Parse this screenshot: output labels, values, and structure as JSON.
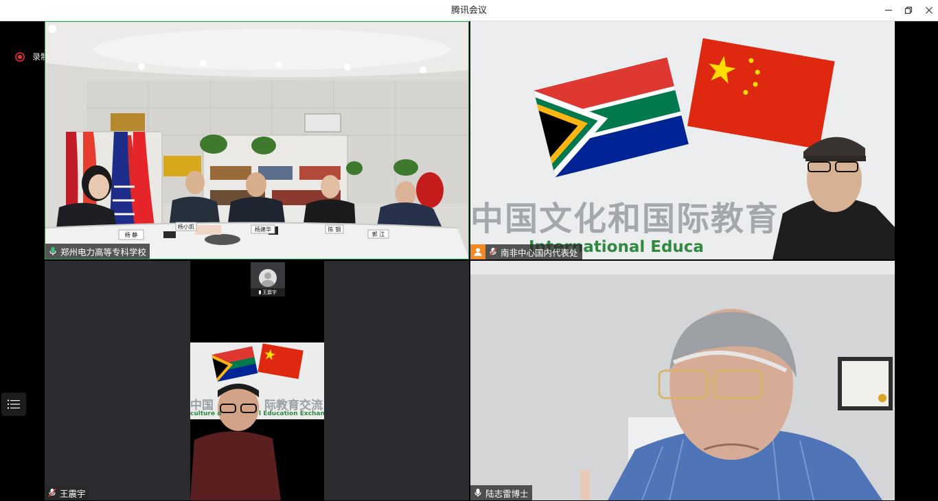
{
  "window": {
    "title": "腾讯会议",
    "minimize_icon": "minimize-icon",
    "restore_icon": "restore-icon",
    "close_icon": "close-icon"
  },
  "recording": {
    "label": "录制中",
    "color": "#e4393c"
  },
  "tiles": [
    {
      "name": "郑州电力高等专科学校",
      "mic": "mic-on"
    },
    {
      "name": "南非中心国内代表处",
      "mic": "mic-muted",
      "avatar": "user-icon"
    },
    {
      "name": "王震宇",
      "mic": "mic-muted",
      "thumb_name": "王震宇"
    },
    {
      "name": "陆志雷博士",
      "mic": "mic-on"
    }
  ],
  "backdrop": {
    "banner_cn": "中国文化和国际教育",
    "banner_en": "International Educa",
    "banner_cn_small": "中国",
    "banner_cn_small2": "际教育交流",
    "banner_en_small": "culture a",
    "banner_en_small2": "l Education Exchan"
  },
  "name_cards": [
    "杨 静",
    "杨小凯",
    "杨建华",
    "陈 钢",
    "郭 江"
  ],
  "colors": {
    "active_border": "#1aad52",
    "accent": "#f08a24"
  }
}
